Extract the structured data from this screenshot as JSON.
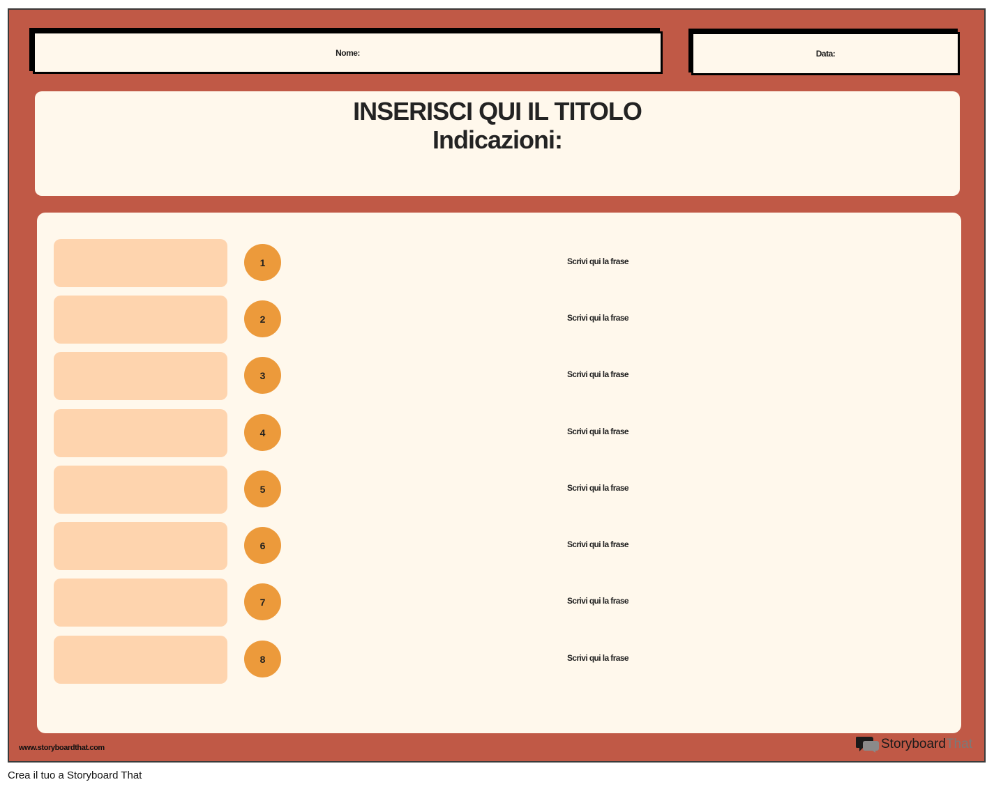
{
  "header": {
    "name_label": "Nome:",
    "date_label": "Data:"
  },
  "title_panel": {
    "title": "INSERISCI QUI IL TITOLO",
    "subtitle": "Indicazioni:"
  },
  "rows": [
    {
      "number": "1",
      "sentence": "Scrivi qui la frase"
    },
    {
      "number": "2",
      "sentence": "Scrivi qui la frase"
    },
    {
      "number": "3",
      "sentence": "Scrivi qui la frase"
    },
    {
      "number": "4",
      "sentence": "Scrivi qui la frase"
    },
    {
      "number": "5",
      "sentence": "Scrivi qui la frase"
    },
    {
      "number": "6",
      "sentence": "Scrivi qui la frase"
    },
    {
      "number": "7",
      "sentence": "Scrivi qui la frase"
    },
    {
      "number": "8",
      "sentence": "Scrivi qui la frase"
    }
  ],
  "footer": {
    "url": "www.storyboardthat.com",
    "brand_part1": "Storyboard",
    "brand_part2": "That",
    "logo_icon": "speech-bubbles-icon"
  },
  "caption": "Crea il tuo a Storyboard That",
  "colors": {
    "background": "#c05946",
    "panel": "#fff8ec",
    "slot": "#fed4ae",
    "number_circle": "#ec9a3b"
  }
}
